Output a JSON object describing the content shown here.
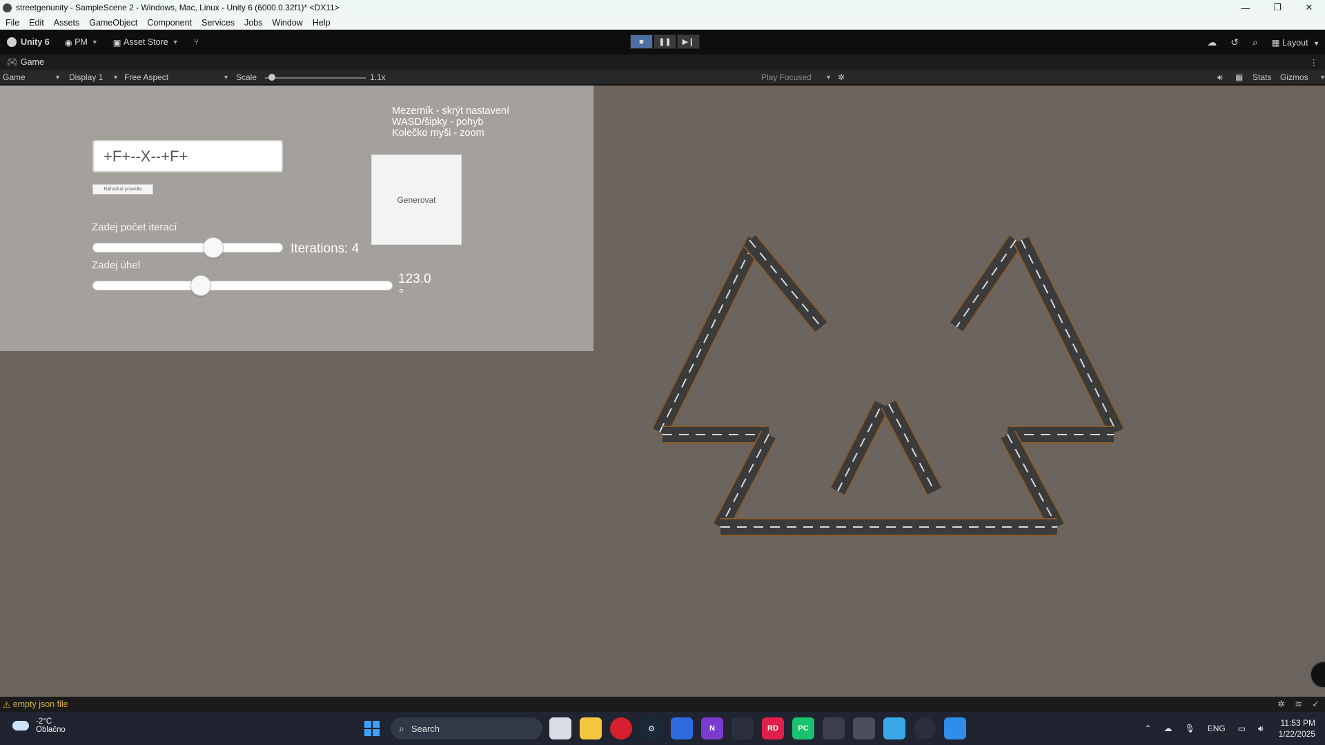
{
  "window": {
    "title": "streetgenunity - SampleScene 2 - Windows, Mac, Linux - Unity 6 (6000.0.32f1)* <DX11>",
    "controls": [
      "minimize-icon",
      "restore-icon",
      "close-icon"
    ]
  },
  "menu": [
    "File",
    "Edit",
    "Assets",
    "GameObject",
    "Component",
    "Services",
    "Jobs",
    "Window",
    "Help"
  ],
  "toolbar": {
    "unity_label": "Unity 6",
    "account_label": "PM",
    "asset_store_label": "Asset Store",
    "layout_label": "Layout",
    "play_active": "stop"
  },
  "game_tab": {
    "label": "Game"
  },
  "game_toolbar": {
    "mode": "Game",
    "display": "Display 1",
    "aspect": "Free Aspect",
    "scale_label": "Scale",
    "scale_value": "1.1x",
    "play_focused": "Play Focused",
    "stats": "Stats",
    "gizmos": "Gizmos"
  },
  "ui": {
    "rule_input": "+F+--X--+F+",
    "small_button": "Náhodná pravidla",
    "iterations_label": "Zadej počet iterací",
    "iterations_value_text": "Iterations: 4",
    "iterations_fraction": 0.65,
    "angle_label": "Zadej úhel",
    "angle_value": "123.0",
    "angle_fraction": 0.35,
    "generate_button": "Generovat",
    "help_lines": [
      "Mezerník - skrýt nastavení",
      "WASD/šipky - pohyb",
      "Kolečko myši - zoom"
    ]
  },
  "status": {
    "message": "empty json file",
    "severity": "warning"
  },
  "taskbar": {
    "weather_temp": "-2°C",
    "weather_desc": "Oblačno",
    "search_placeholder": "Search",
    "language": "ENG",
    "time": "11:53 PM",
    "date": "1/22/2025"
  },
  "colors": {
    "viewport_bg": "#6c645e",
    "panel_bg": "#a4a09c",
    "road": "#3b3b3b",
    "road_edge": "#8a5a2a",
    "accent_play": "#4e6fa3",
    "warning": "#d4b342"
  }
}
